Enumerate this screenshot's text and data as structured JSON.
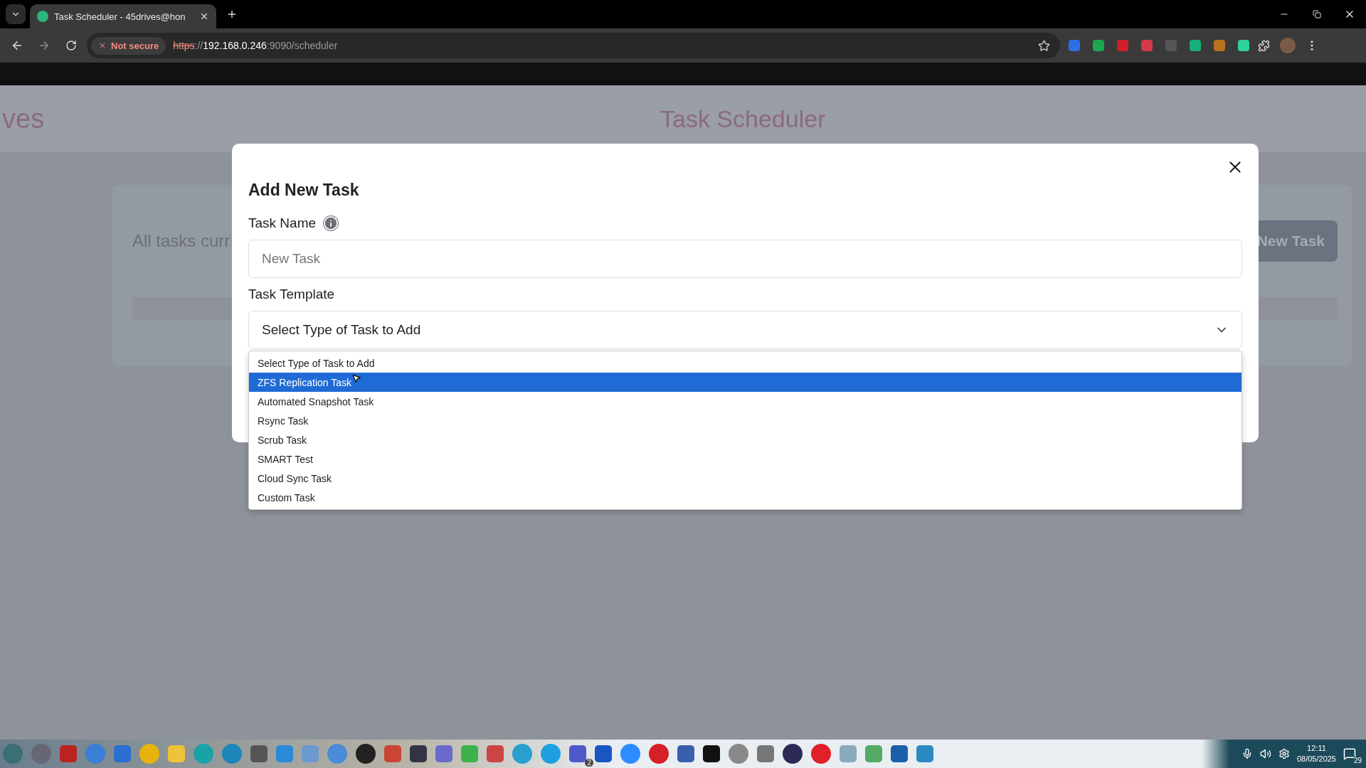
{
  "browser": {
    "tab": {
      "title": "Task Scheduler - 45drives@hon",
      "selected": true
    },
    "security": "Not secure",
    "url": [
      {
        "text": "https",
        "kind": "scheme"
      },
      {
        "text": "://",
        "kind": "dim"
      },
      {
        "text": "192.168.0.246",
        "kind": "host"
      },
      {
        "text": ":9090/scheduler",
        "kind": "dim"
      }
    ]
  },
  "page": {
    "brand": "ves",
    "title": "Task Scheduler",
    "card_text": "All tasks curr",
    "new_task_button": "New Task"
  },
  "modal": {
    "title": "Add New Task",
    "name_label": "Task Name",
    "name_placeholder": "New Task",
    "template_label": "Task Template",
    "template_value": "Select Type of Task to Add",
    "options": [
      {
        "label": "Select Type of Task to Add",
        "selected": false
      },
      {
        "label": "ZFS Replication Task",
        "selected": true
      },
      {
        "label": "Automated Snapshot Task",
        "selected": false
      },
      {
        "label": "Rsync Task",
        "selected": false
      },
      {
        "label": "Scrub Task",
        "selected": false
      },
      {
        "label": "SMART Test",
        "selected": false
      },
      {
        "label": "Cloud Sync Task",
        "selected": false
      },
      {
        "label": "Custom Task",
        "selected": false
      }
    ]
  },
  "taskbar": {
    "teams_badge": "2",
    "time": "12:11",
    "date": "08/05/2025",
    "notifications": "29"
  }
}
